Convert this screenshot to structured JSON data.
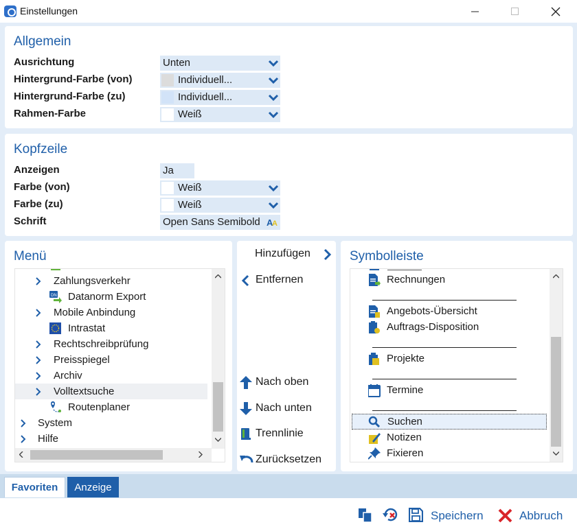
{
  "window": {
    "title": "Einstellungen"
  },
  "allgemein": {
    "title": "Allgemein",
    "rows": [
      {
        "label": "Ausrichtung",
        "value": "Unten",
        "swatch": ""
      },
      {
        "label": "Hintergrund-Farbe (von)",
        "value": "Individuell...",
        "swatch": "#dcdcdc"
      },
      {
        "label": "Hintergrund-Farbe (zu)",
        "value": "Individuell...",
        "swatch": "#dce9f9"
      },
      {
        "label": "Rahmen-Farbe",
        "value": "Weiß",
        "swatch": "#ffffff"
      }
    ]
  },
  "kopfzeile": {
    "title": "Kopfzeile",
    "rows": [
      {
        "label": "Anzeigen",
        "value": "Ja"
      },
      {
        "label": "Farbe (von)",
        "value": "Weiß",
        "swatch": "#ffffff"
      },
      {
        "label": "Farbe (zu)",
        "value": "Weiß",
        "swatch": "#ffffff"
      },
      {
        "label": "Schrift",
        "value": "Open Sans Semibold"
      }
    ]
  },
  "menu": {
    "title": "Menü",
    "items": [
      {
        "label": "Zahlungsverkehr"
      },
      {
        "label": "Datanorm Export"
      },
      {
        "label": "Mobile Anbindung"
      },
      {
        "label": "Intrastat"
      },
      {
        "label": "Rechtschreibprüfung"
      },
      {
        "label": "Preisspiegel"
      },
      {
        "label": "Archiv"
      },
      {
        "label": "Volltextsuche"
      },
      {
        "label": "Routenplaner"
      },
      {
        "label": "System"
      },
      {
        "label": "Hilfe"
      }
    ]
  },
  "actions": {
    "add": "Hinzufügen",
    "remove": "Entfernen",
    "up": "Nach oben",
    "down": "Nach unten",
    "separator": "Trennlinie",
    "reset": "Zurücksetzen"
  },
  "symbolleiste": {
    "title": "Symbolleiste",
    "items": [
      {
        "label": "Rechnungen"
      },
      {
        "label": "Angebots-Übersicht"
      },
      {
        "label": "Auftrags-Disposition"
      },
      {
        "label": "Projekte"
      },
      {
        "label": "Termine"
      },
      {
        "label": "Suchen"
      },
      {
        "label": "Notizen"
      },
      {
        "label": "Fixieren"
      }
    ]
  },
  "tabs": [
    {
      "label": "Favoriten",
      "active": true
    },
    {
      "label": "Anzeige",
      "active": false
    }
  ],
  "footer": {
    "save": "Speichern",
    "cancel": "Abbruch"
  },
  "colors": {
    "accent": "#1f5fa9",
    "background": "#e3edf8",
    "field": "#dde9f6",
    "cancel_red": "#d9252a"
  }
}
